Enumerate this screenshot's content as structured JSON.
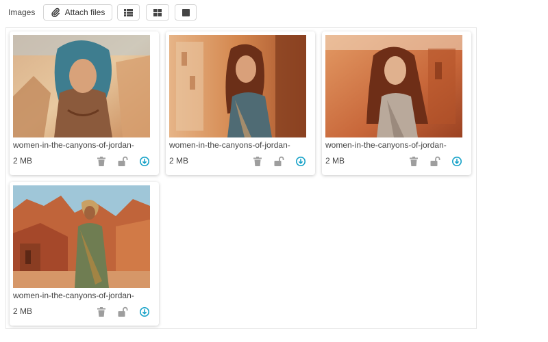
{
  "toolbar": {
    "label": "Images",
    "attach_label": "Attach files",
    "view_icons": [
      "list-icon",
      "grid-icon",
      "single-view-icon"
    ]
  },
  "files": [
    {
      "name": "women-in-the-canyons-of-jordan-",
      "size": "2 MB"
    },
    {
      "name": "women-in-the-canyons-of-jordan-",
      "size": "2 MB"
    },
    {
      "name": "women-in-the-canyons-of-jordan-",
      "size": "2 MB"
    },
    {
      "name": "women-in-the-canyons-of-jordan-",
      "size": "2 MB"
    }
  ],
  "colors": {
    "action_icon": "#9e9e9e",
    "download_icon": "#17a2c8",
    "border": "#d6d6d6"
  }
}
